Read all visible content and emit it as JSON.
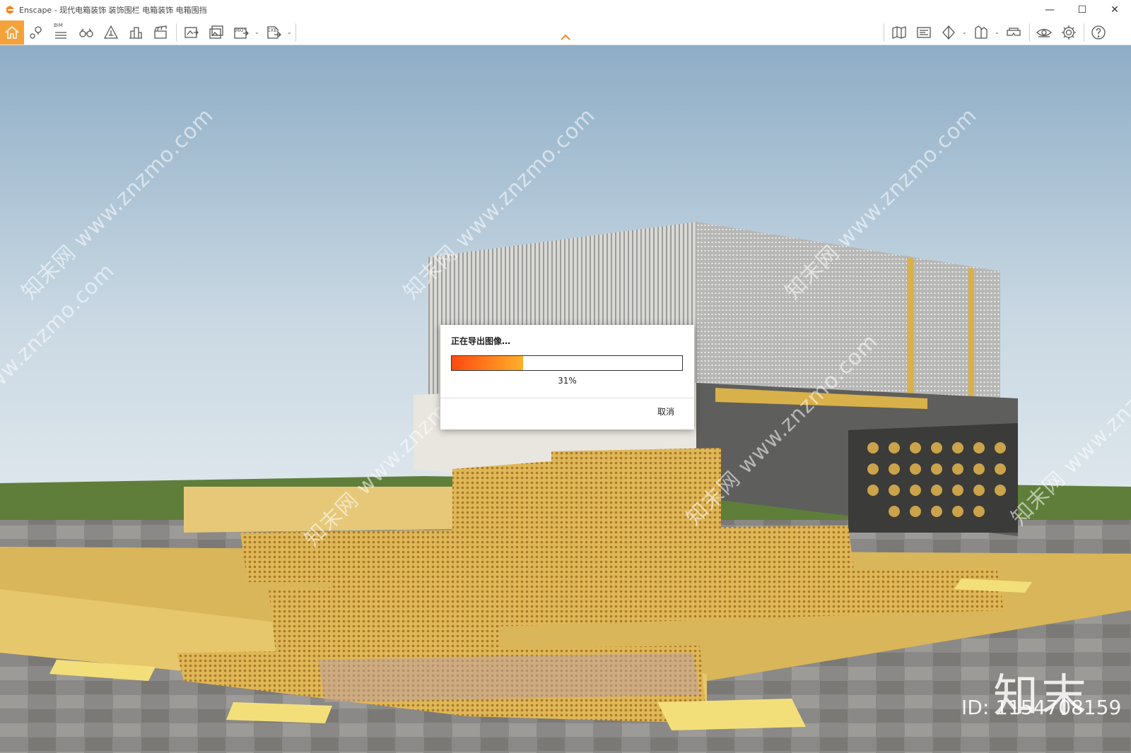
{
  "window": {
    "app_name": "Enscape",
    "title": "Enscape - 现代电箱装饰 装饰围栏 电箱装饰 电箱围挡",
    "controls": {
      "minimize": "—",
      "maximize": "☐",
      "close": "✕"
    }
  },
  "toolbar": {
    "accent_color": "#f6a23a",
    "left_tools": [
      {
        "name": "home-icon"
      },
      {
        "name": "location-pin-icon"
      },
      {
        "name": "bim-icon",
        "label": "BIM"
      },
      {
        "name": "binoculars-icon"
      },
      {
        "name": "atmosphere-icon"
      },
      {
        "name": "buildings-icon"
      },
      {
        "name": "video-editor-icon"
      },
      {
        "name": "screenshot-icon"
      },
      {
        "name": "batch-render-icon"
      },
      {
        "name": "panorama-360-icon",
        "label": "360°"
      },
      {
        "name": "export-exe-icon",
        "label": "EXE"
      }
    ],
    "right_tools": [
      {
        "name": "map-icon"
      },
      {
        "name": "mini-map-icon"
      },
      {
        "name": "vr-icon"
      },
      {
        "name": "asset-library-icon"
      },
      {
        "name": "vr-headset-icon"
      },
      {
        "name": "view-visibility-icon"
      },
      {
        "name": "settings-gear-icon"
      },
      {
        "name": "help-icon",
        "label": "?"
      }
    ]
  },
  "viewport": {
    "watermark": "知末网 www.znzmo.com",
    "brand_logo": "知末",
    "brand_id": "ID: 1154708159"
  },
  "export_dialog": {
    "title": "正在导出图像…",
    "progress_percent": 31,
    "progress_text": "31%",
    "cancel_label": "取消"
  }
}
